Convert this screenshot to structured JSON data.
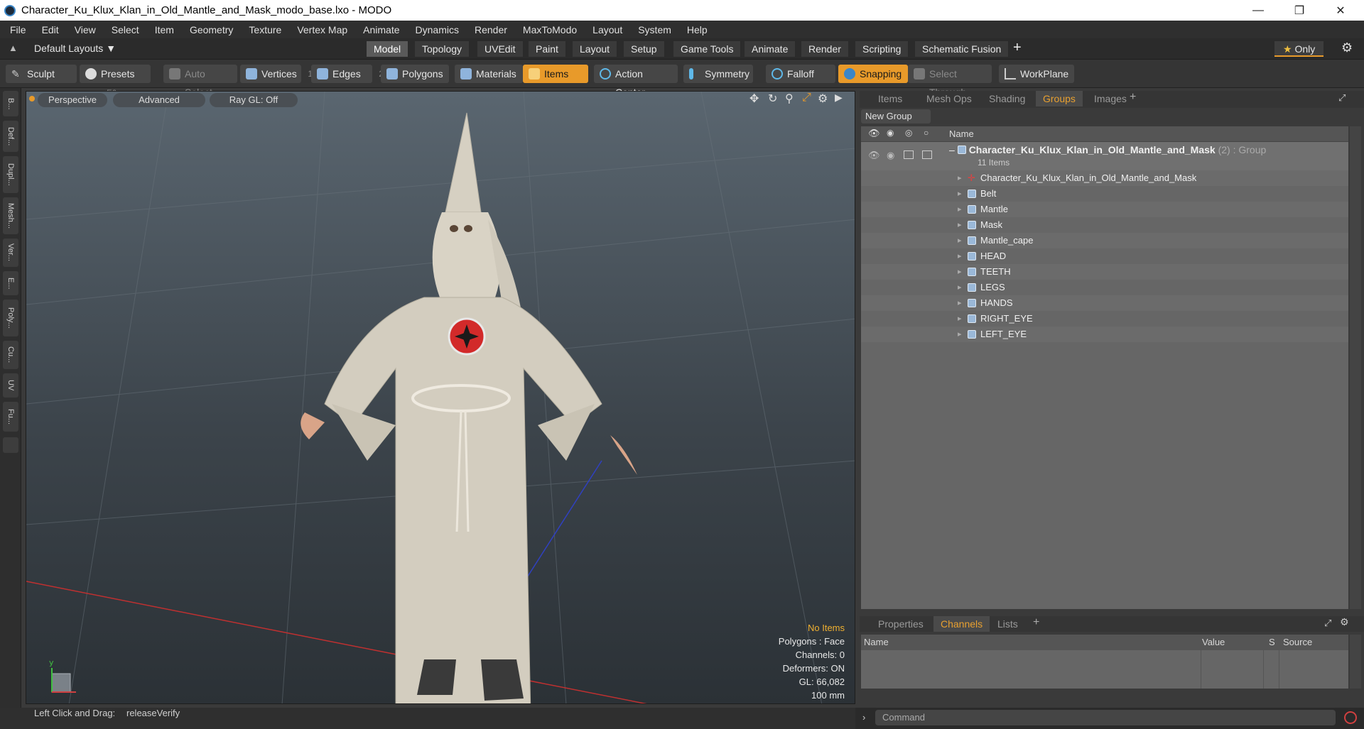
{
  "window": {
    "title": "Character_Ku_Klux_Klan_in_Old_Mantle_and_Mask_modo_base.lxo - MODO"
  },
  "menu": [
    "File",
    "Edit",
    "View",
    "Select",
    "Item",
    "Geometry",
    "Texture",
    "Vertex Map",
    "Animate",
    "Dynamics",
    "Render",
    "MaxToModo",
    "Layout",
    "System",
    "Help"
  ],
  "layouts": {
    "dropdown": "Default Layouts",
    "tabs": [
      "Model",
      "Topology",
      "UVEdit",
      "Paint",
      "Layout",
      "Setup",
      "Game Tools",
      "Animate",
      "Render",
      "Scripting",
      "Schematic Fusion"
    ],
    "active": "Model",
    "only_label": "Only"
  },
  "toolbar": {
    "sculpt": "Sculpt",
    "presets": "Presets",
    "presets_key": "F6",
    "auto_select": "Auto Select",
    "vertices": "Vertices",
    "vertices_count": "1",
    "edges": "Edges",
    "edges_count": "2",
    "polygons": "Polygons",
    "materials": "Materials",
    "items": "Items",
    "action_center": "Action Center",
    "symmetry": "Symmetry",
    "falloff": "Falloff",
    "snapping": "Snapping",
    "select_through": "Select Through",
    "workplane": "WorkPlane"
  },
  "leftstrip": [
    "B...",
    "Def...",
    "Dupl...",
    "Mesh...",
    "Ver...",
    "E...",
    "Poly...",
    "Cu...",
    "UV",
    "Fu..."
  ],
  "viewport": {
    "perspective": "Perspective",
    "advanced": "Advanced",
    "raygl": "Ray GL: Off",
    "info": {
      "no_items": "No Items",
      "polygons": "Polygons : Face",
      "channels": "Channels: 0",
      "deformers": "Deformers: ON",
      "gl": "GL: 66,082",
      "unit": "100 mm"
    }
  },
  "scene_panel": {
    "tabs": [
      "Items",
      "Mesh Ops",
      "Shading",
      "Groups",
      "Images"
    ],
    "active": "Groups",
    "new_group": "New Group",
    "col_name": "Name",
    "group": {
      "name": "Character_Ku_Klux_Klan_in_Old_Mantle_and_Mask",
      "count_suffix": "(2) : Group",
      "items_label": "11 Items"
    },
    "children": [
      "Character_Ku_Klux_Klan_in_Old_Mantle_and_Mask",
      "Belt",
      "Mantle",
      "Mask",
      "Mantle_cape",
      "HEAD",
      "TEETH",
      "LEGS",
      "HANDS",
      "RIGHT_EYE",
      "LEFT_EYE"
    ]
  },
  "props_panel": {
    "tabs": [
      "Properties",
      "Channels",
      "Lists"
    ],
    "active": "Channels",
    "columns": [
      "Name",
      "Value",
      "S",
      "Source"
    ]
  },
  "status": {
    "hint": "Left Click and Drag:",
    "value": "releaseVerify"
  },
  "command": {
    "placeholder": "Command"
  },
  "colors": {
    "accent": "#e89a2a",
    "viewport_top": "#5a6670",
    "list_bg": "#666666"
  }
}
